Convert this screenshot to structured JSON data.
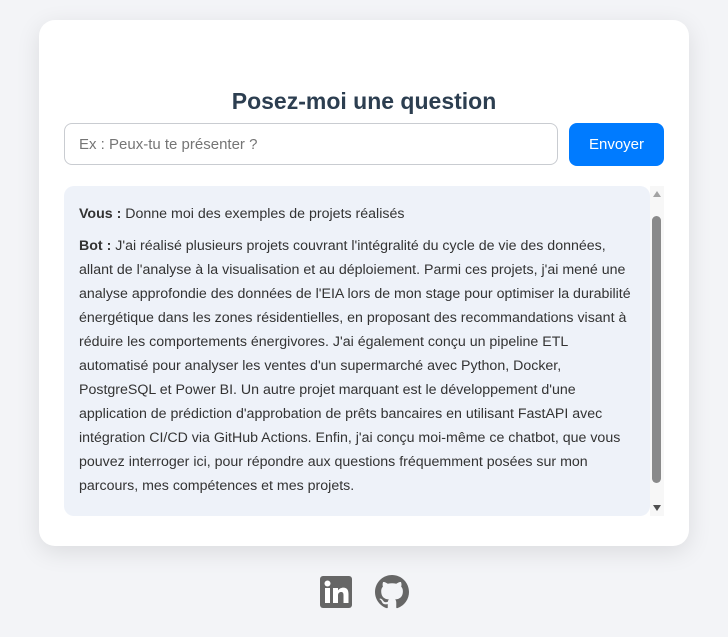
{
  "header": {
    "title": "Posez-moi une question"
  },
  "input": {
    "placeholder": "Ex : Peux-tu te présenter ?",
    "value": ""
  },
  "send_button": {
    "label": "Envoyer"
  },
  "chat": {
    "messages": [
      {
        "speaker": "Vous :",
        "text": "Donne moi des exemples de projets réalisés"
      },
      {
        "speaker": "Bot :",
        "text": "J'ai réalisé plusieurs projets couvrant l'intégralité du cycle de vie des données, allant de l'analyse à la visualisation et au déploiement. Parmi ces projets, j'ai mené une analyse approfondie des données de l'EIA lors de mon stage pour optimiser la durabilité énergétique dans les zones résidentielles, en proposant des recommandations visant à réduire les comportements énergivores. J'ai également conçu un pipeline ETL automatisé pour analyser les ventes d'un supermarché avec Python, Docker, PostgreSQL et Power BI. Un autre projet marquant est le développement d'une application de prédiction d'approbation de prêts bancaires en utilisant FastAPI avec intégration CI/CD via GitHub Actions. Enfin, j'ai conçu moi-même ce chatbot, que vous pouvez interroger ici, pour répondre aux questions fréquemment posées sur mon parcours, mes compétences et mes projets."
      }
    ]
  },
  "footer": {
    "links": [
      {
        "icon": "linkedin-icon"
      },
      {
        "icon": "github-icon"
      }
    ]
  },
  "colors": {
    "page_background": "#f3f4f7",
    "card_background": "#ffffff",
    "title": "#2c3e50",
    "accent": "#007bff",
    "chat_background": "#eef2f9",
    "icon": "#666666"
  }
}
